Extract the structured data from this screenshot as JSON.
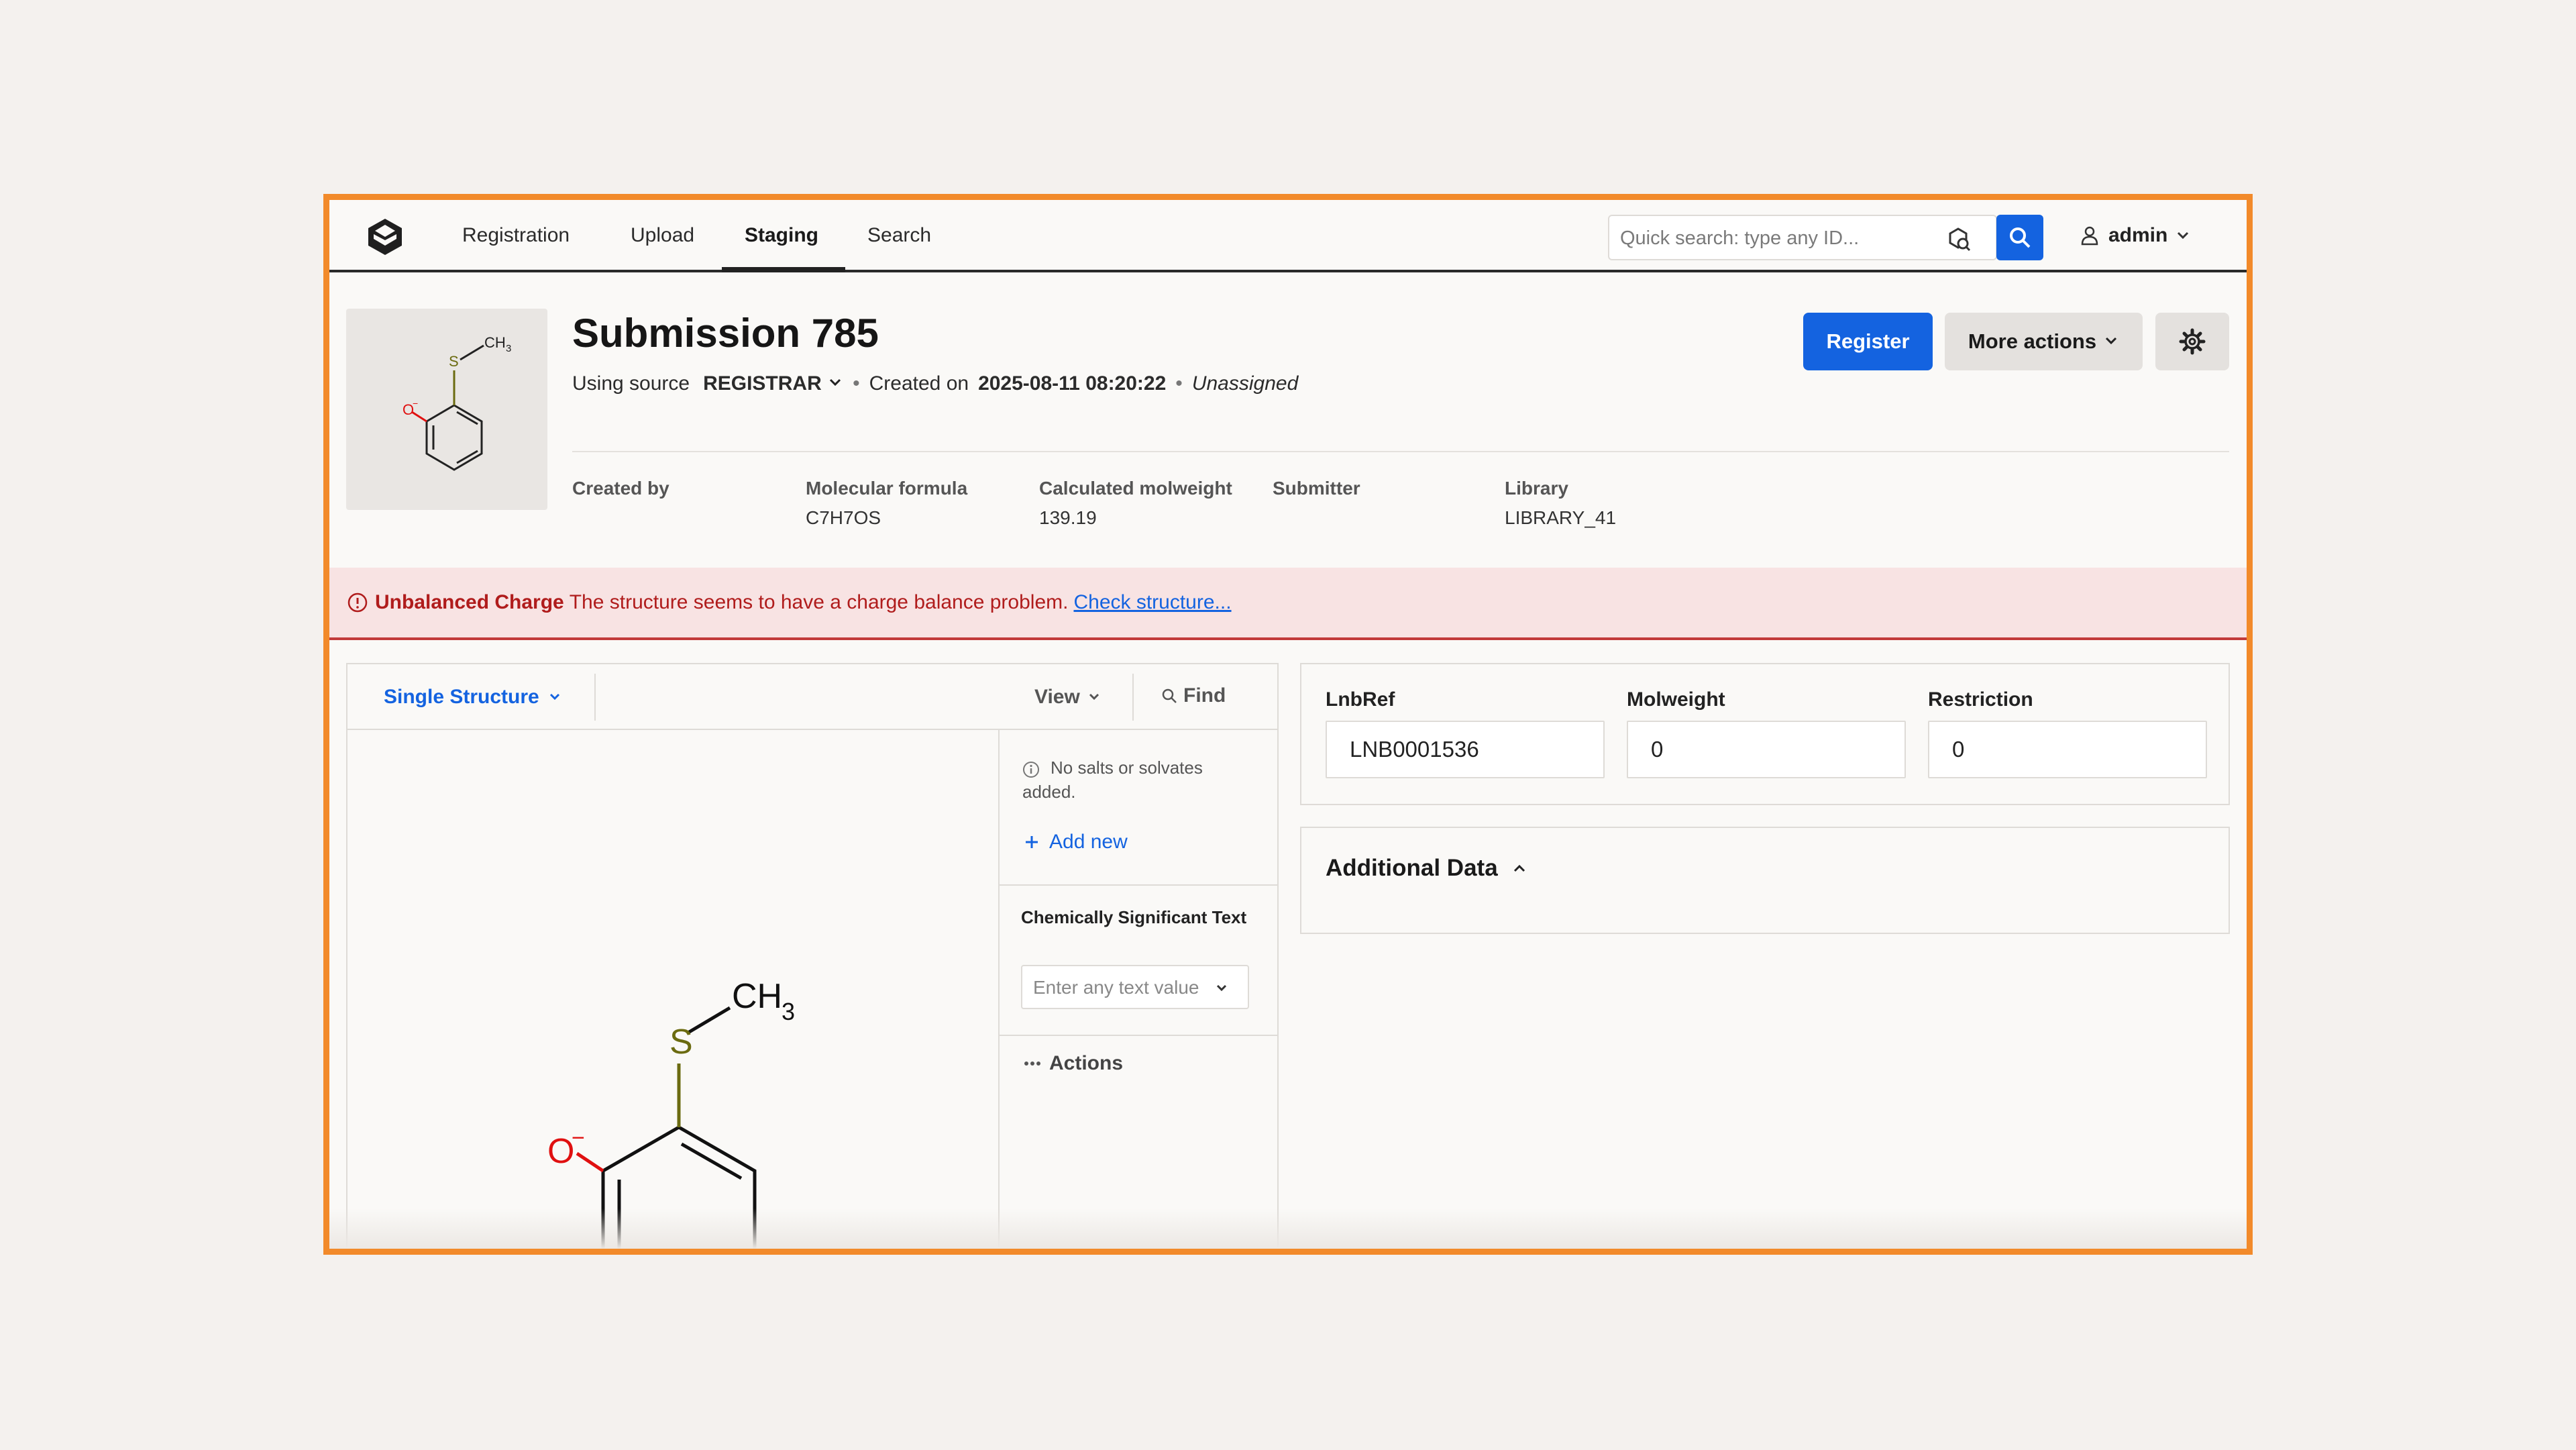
{
  "brand": {
    "accent": "#1463e0",
    "frame": "#f28a2a",
    "error": "#b01c1c"
  },
  "nav": {
    "items": [
      {
        "label": "Registration"
      },
      {
        "label": "Upload"
      },
      {
        "label": "Staging",
        "active": true
      },
      {
        "label": "Search"
      }
    ],
    "search_placeholder": "Quick search: type any ID...",
    "user": "admin"
  },
  "submission": {
    "title": "Submission 785",
    "using_source_label": "Using source",
    "source": "REGISTRAR",
    "created_on_label": "Created on",
    "created_on": "2025-08-11 08:20:22",
    "assignee": "Unassigned",
    "meta": [
      {
        "label": "Created by",
        "value": ""
      },
      {
        "label": "Molecular formula",
        "value": "C7H7OS"
      },
      {
        "label": "Calculated molweight",
        "value": "139.19"
      },
      {
        "label": "Submitter",
        "value": ""
      },
      {
        "label": "Library",
        "value": "LIBRARY_41"
      }
    ],
    "actions": {
      "register": "Register",
      "more": "More actions"
    }
  },
  "alert": {
    "title": "Unbalanced Charge",
    "message": "The structure seems to have a charge balance problem.",
    "link": "Check structure..."
  },
  "structure_panel": {
    "mode": "Single Structure",
    "view": "View",
    "find": "Find",
    "no_salts": "No salts or solvates added.",
    "add_new": "Add new",
    "chem_text_label": "Chemically Significant Text",
    "chem_text_placeholder": "Enter any text value",
    "actions": "Actions"
  },
  "molecule": {
    "atoms": {
      "oxygen": "O",
      "charge": "−",
      "sulfur": "S",
      "methyl": "CH",
      "methyl_sub": "3"
    },
    "colors": {
      "oxygen": "#e01010",
      "sulfur": "#6b6b10"
    }
  },
  "fields": [
    {
      "label": "LnbRef",
      "value": "LNB0001536"
    },
    {
      "label": "Molweight",
      "value": "0"
    },
    {
      "label": "Restriction",
      "value": "0"
    }
  ],
  "additional": {
    "title": "Additional Data"
  }
}
